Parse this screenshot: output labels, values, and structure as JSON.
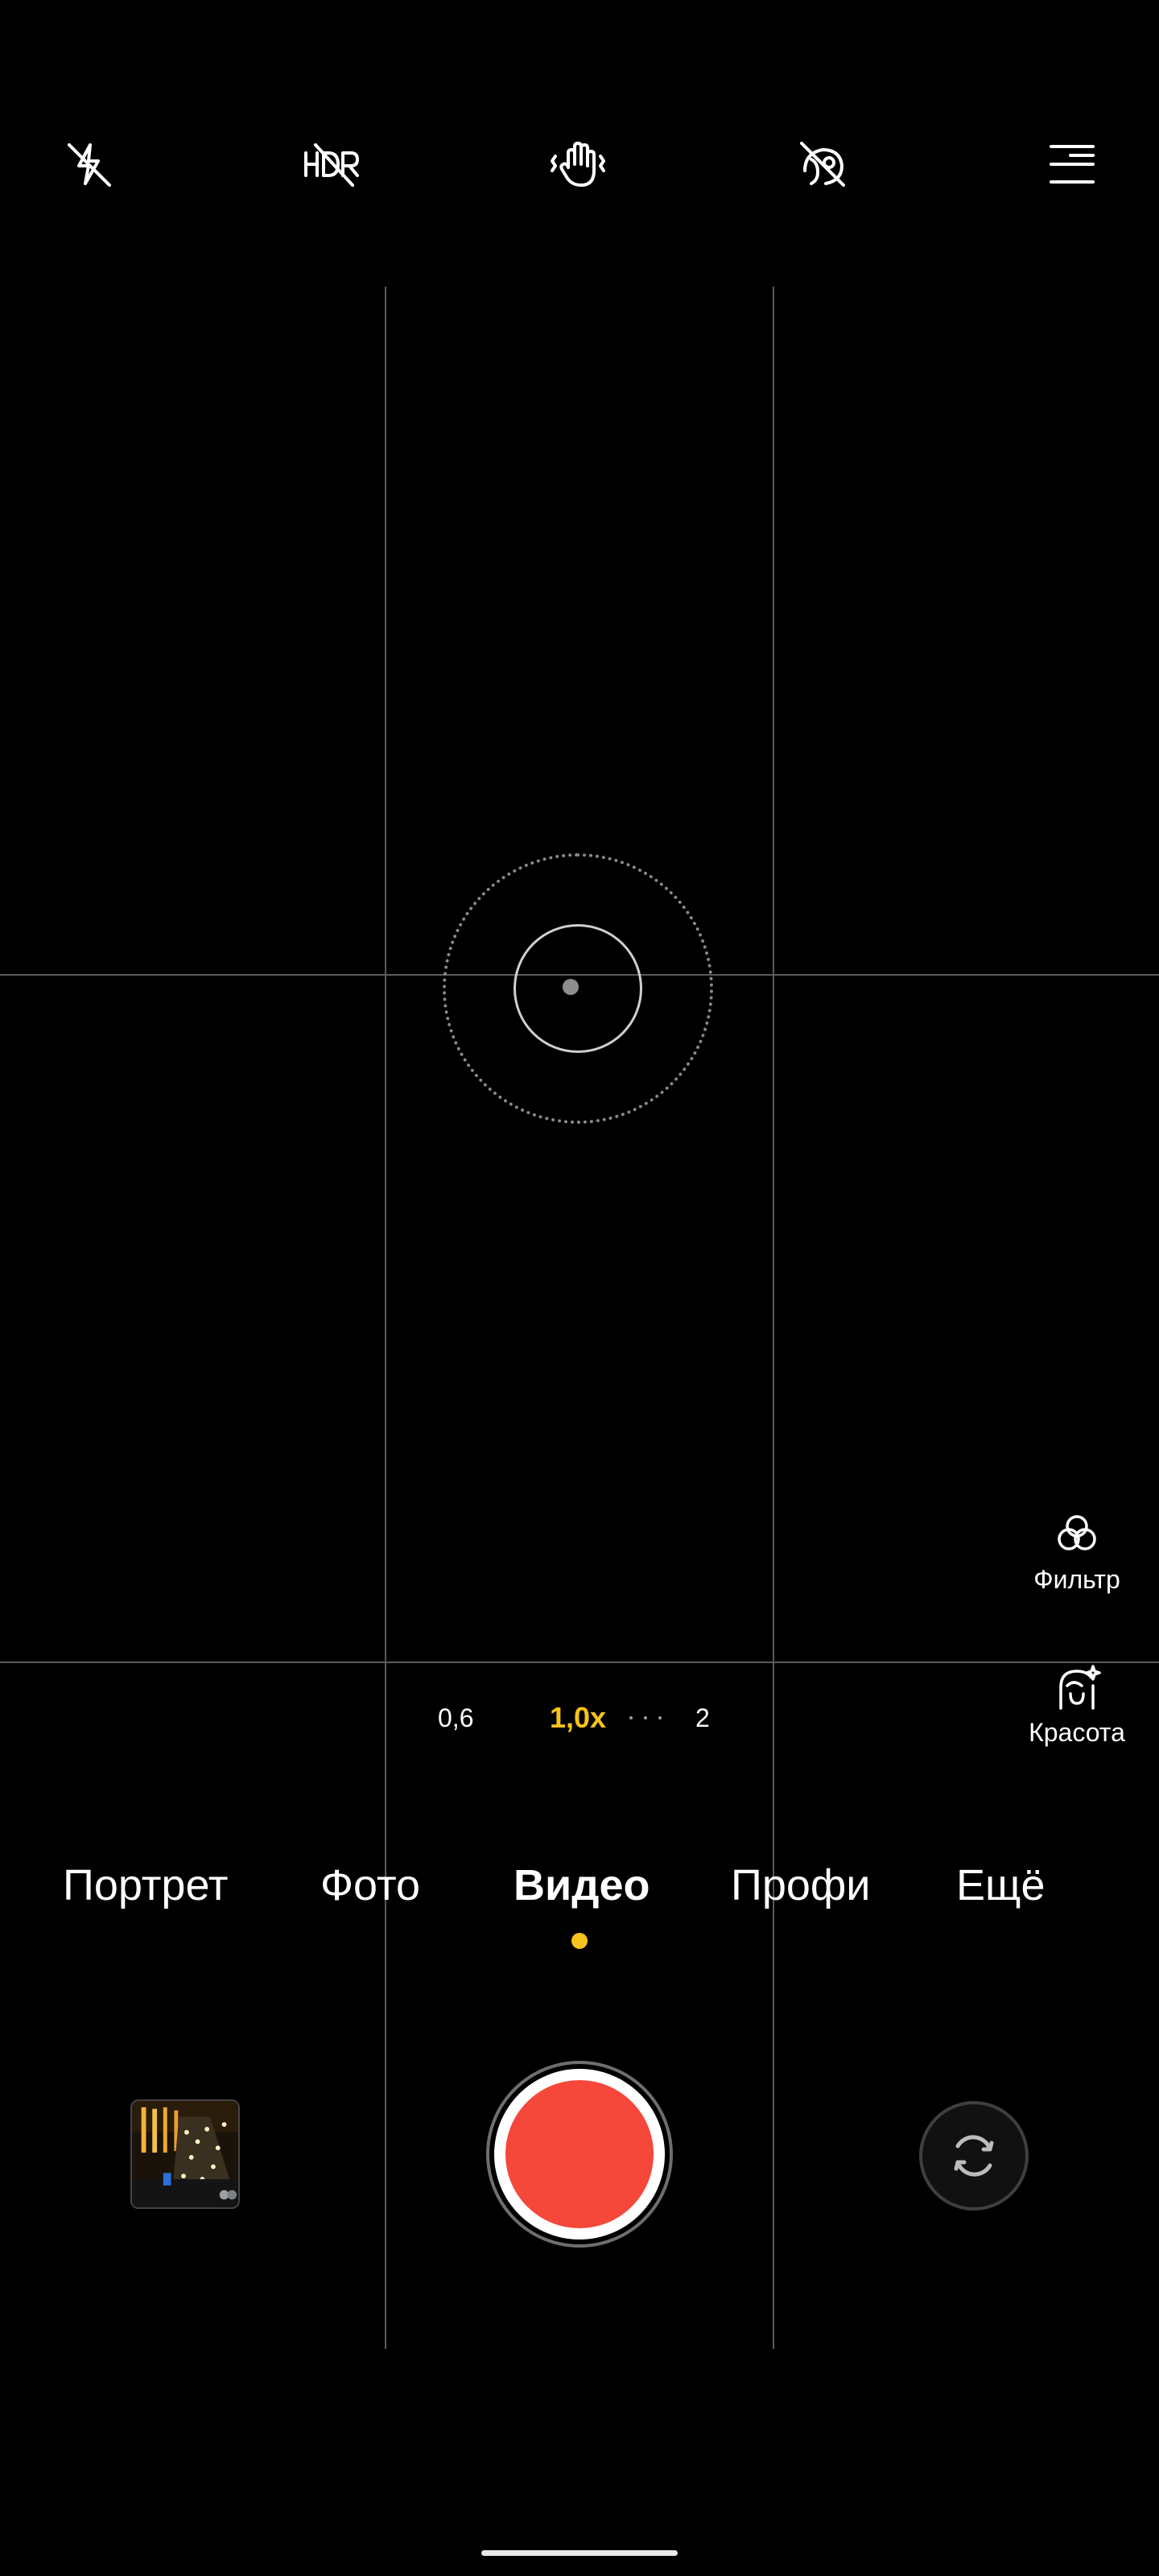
{
  "toolbar": {
    "icons": [
      "flash-off-icon",
      "hdr-off-icon",
      "stabilization-icon",
      "ai-scene-off-icon",
      "menu-icon"
    ]
  },
  "side_tools": {
    "filter_label": "Фильтр",
    "beauty_label": "Красота"
  },
  "zoom": {
    "levels": [
      "0,6",
      "1,0x",
      "2"
    ],
    "active": "1,0x"
  },
  "modes": {
    "items": [
      "Портрет",
      "Фото",
      "Видео",
      "Профи",
      "Ещё"
    ],
    "active": "Видео"
  },
  "colors": {
    "accent": "#f6c21c",
    "record": "#f5473a"
  }
}
